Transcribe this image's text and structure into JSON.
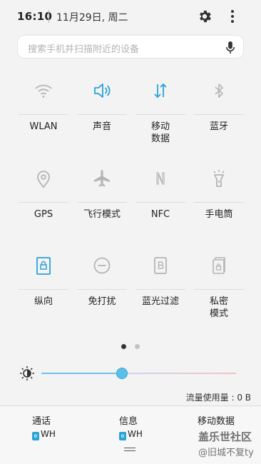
{
  "status": {
    "time": "16:10",
    "date": "11月29日, 周二"
  },
  "search": {
    "placeholder": "搜索手机并扫描附近的设备"
  },
  "tiles": [
    {
      "label": "WLAN",
      "icon": "wifi-icon",
      "active": false
    },
    {
      "label": "声音",
      "icon": "volume-icon",
      "active": true
    },
    {
      "label": "移动\n数据",
      "icon": "mobile-data-icon",
      "active": true
    },
    {
      "label": "蓝牙",
      "icon": "bluetooth-icon",
      "active": false
    },
    {
      "label": "GPS",
      "icon": "location-icon",
      "active": false
    },
    {
      "label": "飞行模式",
      "icon": "airplane-icon",
      "active": false
    },
    {
      "label": "NFC",
      "icon": "nfc-icon",
      "active": false
    },
    {
      "label": "手电筒",
      "icon": "flashlight-icon",
      "active": false
    },
    {
      "label": "纵向",
      "icon": "portrait-lock-icon",
      "active": true
    },
    {
      "label": "免打扰",
      "icon": "do-not-disturb-icon",
      "active": false
    },
    {
      "label": "蓝光过滤",
      "icon": "blue-light-filter-icon",
      "active": false
    },
    {
      "label": "私密\n模式",
      "icon": "private-mode-icon",
      "active": false
    }
  ],
  "pages": {
    "count": 2,
    "current": 1
  },
  "brightness": {
    "level": 0.41
  },
  "data_usage": "流量使用量 : 0 B",
  "bottom": [
    {
      "title": "通话",
      "sim": "WH"
    },
    {
      "title": "信息",
      "sim": "WH"
    },
    {
      "title": "移动数据",
      "sim": ""
    }
  ],
  "sim_badge": "e",
  "watermark": {
    "line1": "盖乐世社区",
    "line2": "@旧城不复ty"
  },
  "colors": {
    "active": "#2aa3d8",
    "inactive": "#b5b5b5"
  }
}
